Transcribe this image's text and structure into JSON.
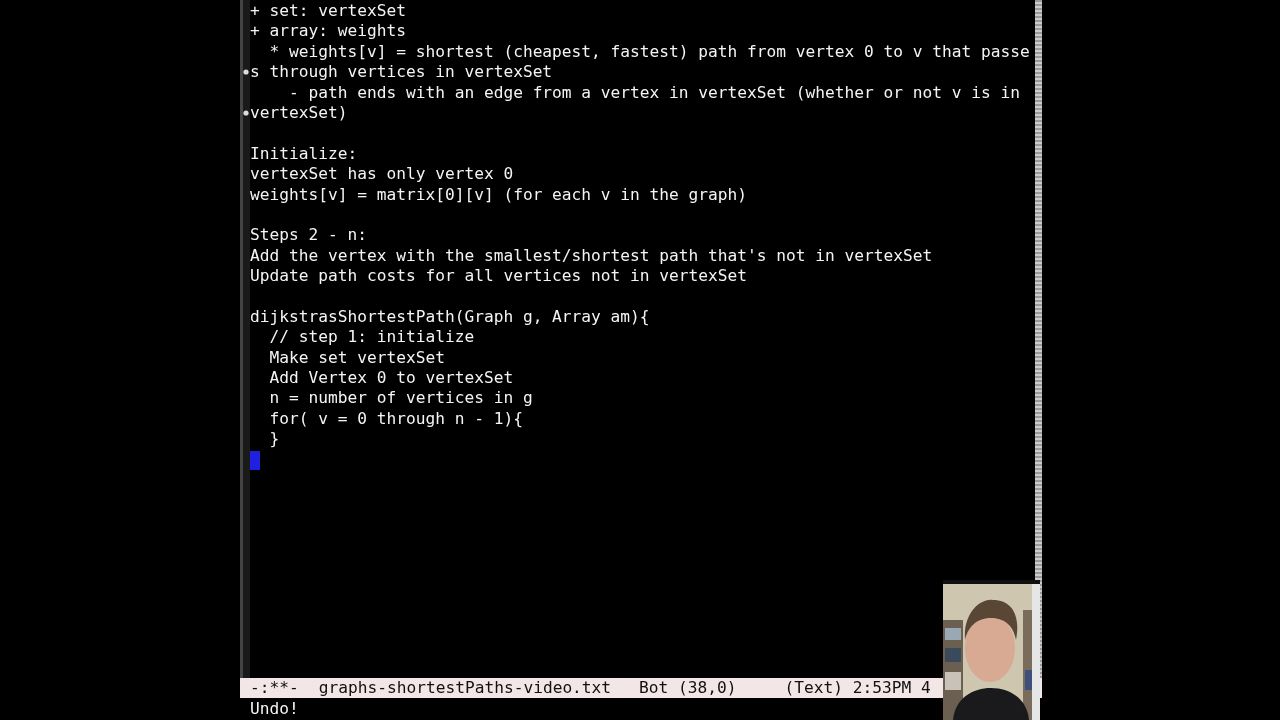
{
  "editor": {
    "lines": [
      {
        "kind": "text",
        "text": "+ set: vertexSet",
        "continued": false
      },
      {
        "kind": "text",
        "text": "+ array: weights",
        "continued": false
      },
      {
        "kind": "text",
        "text": "  * weights[v] = shortest (cheapest, fastest) path from vertex 0 to v that passe",
        "continued": false
      },
      {
        "kind": "text",
        "text": "s through vertices in vertexSet",
        "continued": true
      },
      {
        "kind": "text",
        "text": "    - path ends with an edge from a vertex in vertexSet (whether or not v is in",
        "continued": false
      },
      {
        "kind": "text",
        "text": "vertexSet)",
        "continued": true
      },
      {
        "kind": "blank"
      },
      {
        "kind": "text",
        "text": "Initialize:",
        "continued": false
      },
      {
        "kind": "text",
        "text": "vertexSet has only vertex 0",
        "continued": false
      },
      {
        "kind": "text",
        "text": "weights[v] = matrix[0][v] (for each v in the graph)",
        "continued": false
      },
      {
        "kind": "blank"
      },
      {
        "kind": "text",
        "text": "Steps 2 - n:",
        "continued": false
      },
      {
        "kind": "text",
        "text": "Add the vertex with the smallest/shortest path that's not in vertexSet",
        "continued": false
      },
      {
        "kind": "text",
        "text": "Update path costs for all vertices not in vertexSet",
        "continued": false
      },
      {
        "kind": "blank"
      },
      {
        "kind": "text",
        "text": "dijkstrasShortestPath(Graph g, Array am){",
        "continued": false
      },
      {
        "kind": "text",
        "text": "  // step 1: initialize",
        "continued": false
      },
      {
        "kind": "text",
        "text": "  Make set vertexSet",
        "continued": false
      },
      {
        "kind": "text",
        "text": "  Add Vertex 0 to vertexSet",
        "continued": false
      },
      {
        "kind": "text",
        "text": "  n = number of vertices in g",
        "continued": false
      },
      {
        "kind": "text",
        "text": "  for( v = 0 through n - 1){",
        "continued": false
      },
      {
        "kind": "text",
        "text": "  }",
        "continued": false
      },
      {
        "kind": "cursor"
      }
    ]
  },
  "mode_line": {
    "status": "-:**-",
    "file_name": "graphs-shortestPaths-video.txt",
    "position": "Bot (38,0)",
    "mode": "(Text) 2:53PM 4"
  },
  "echo_area": {
    "message": "Undo!"
  }
}
